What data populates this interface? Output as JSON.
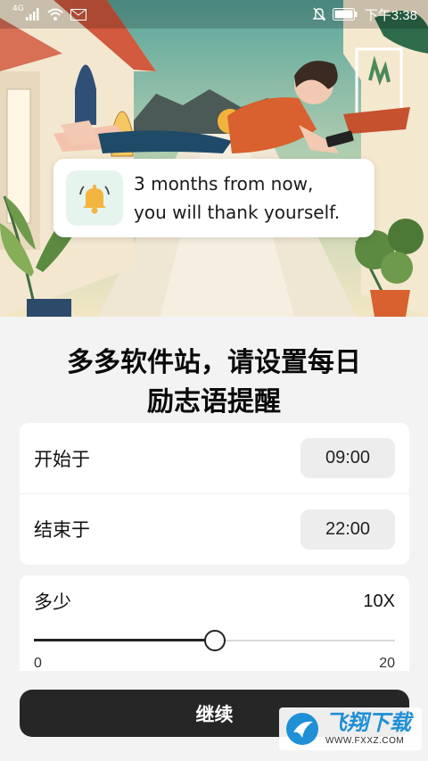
{
  "status_bar": {
    "network": "4G",
    "time": "下午3:38",
    "icons": [
      "signal-icon",
      "wifi-icon",
      "mail-icon",
      "mute-icon",
      "battery-icon"
    ]
  },
  "notification": {
    "icon": "bell-icon",
    "line1": "3 months from now,",
    "line2": "you will thank yourself."
  },
  "title": {
    "line1": "多多软件站，请设置每日",
    "line2": "励志语提醒"
  },
  "schedule": {
    "start_label": "开始于",
    "start_time": "09:00",
    "end_label": "结束于",
    "end_time": "22:00"
  },
  "frequency": {
    "label": "多少",
    "value_text": "10X",
    "min_label": "0",
    "max_label": "20",
    "value": 10,
    "min": 0,
    "max": 20
  },
  "continue_label": "继续",
  "watermark": {
    "main": "飞翔下载",
    "sub": "WWW.FXXZ.COM"
  },
  "colors": {
    "accent_dark": "#262626",
    "chip_bg": "#ededed",
    "bell_bg": "#e6f4ee",
    "bell": "#f3b53f"
  }
}
